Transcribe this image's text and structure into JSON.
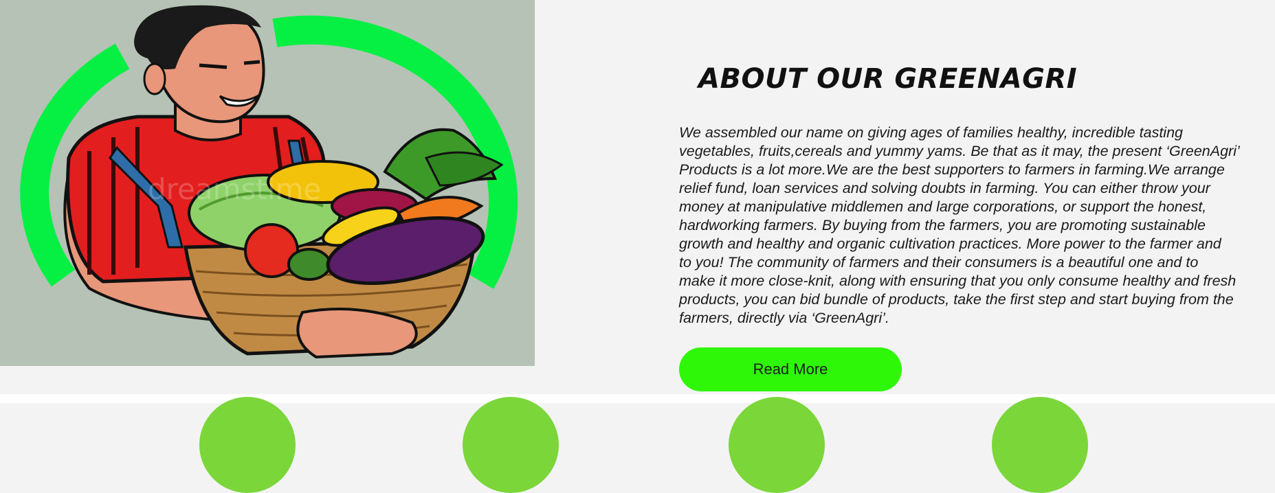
{
  "hero": {
    "image_description": "farmer-with-vegetable-basket-illustration",
    "watermark_text": "dreamstime",
    "colors": {
      "background": "#b5c2b5",
      "ring": "#05f043"
    }
  },
  "about": {
    "title": "ABOUT OUR GREENAGRI",
    "paragraph_lines": [
      "We assembled our name on giving ages of families healthy, incredible tasting",
      "vegetables, fruits,cereals and yummy yams. Be that as it may, the present ‘GreenAgri’",
      "Products is a lot more.We are the best supporters to farmers in farming.We arrange",
      "relief fund, loan services and solving doubts in farming. You can either throw your",
      "money at manipulative middlemen and large corporations, or support the honest,",
      "hardworking farmers. By buying from the farmers, you are promoting sustainable",
      "growth and healthy and organic cultivation practices. More power to the farmer and",
      "to you! The community of farmers and their consumers is a beautiful one and to",
      "make it more close-knit, along with ensuring that you only consume healthy and fresh",
      "products, you can bid bundle of products, take the first step and start buying from the",
      "farmers, directly via ‘GreenAgri’."
    ],
    "button_label": "Read More",
    "colors": {
      "button": "#2ef708",
      "text": "#1a1a1a"
    }
  },
  "features": {
    "circle_color": "#7bd63a",
    "count": 4
  }
}
